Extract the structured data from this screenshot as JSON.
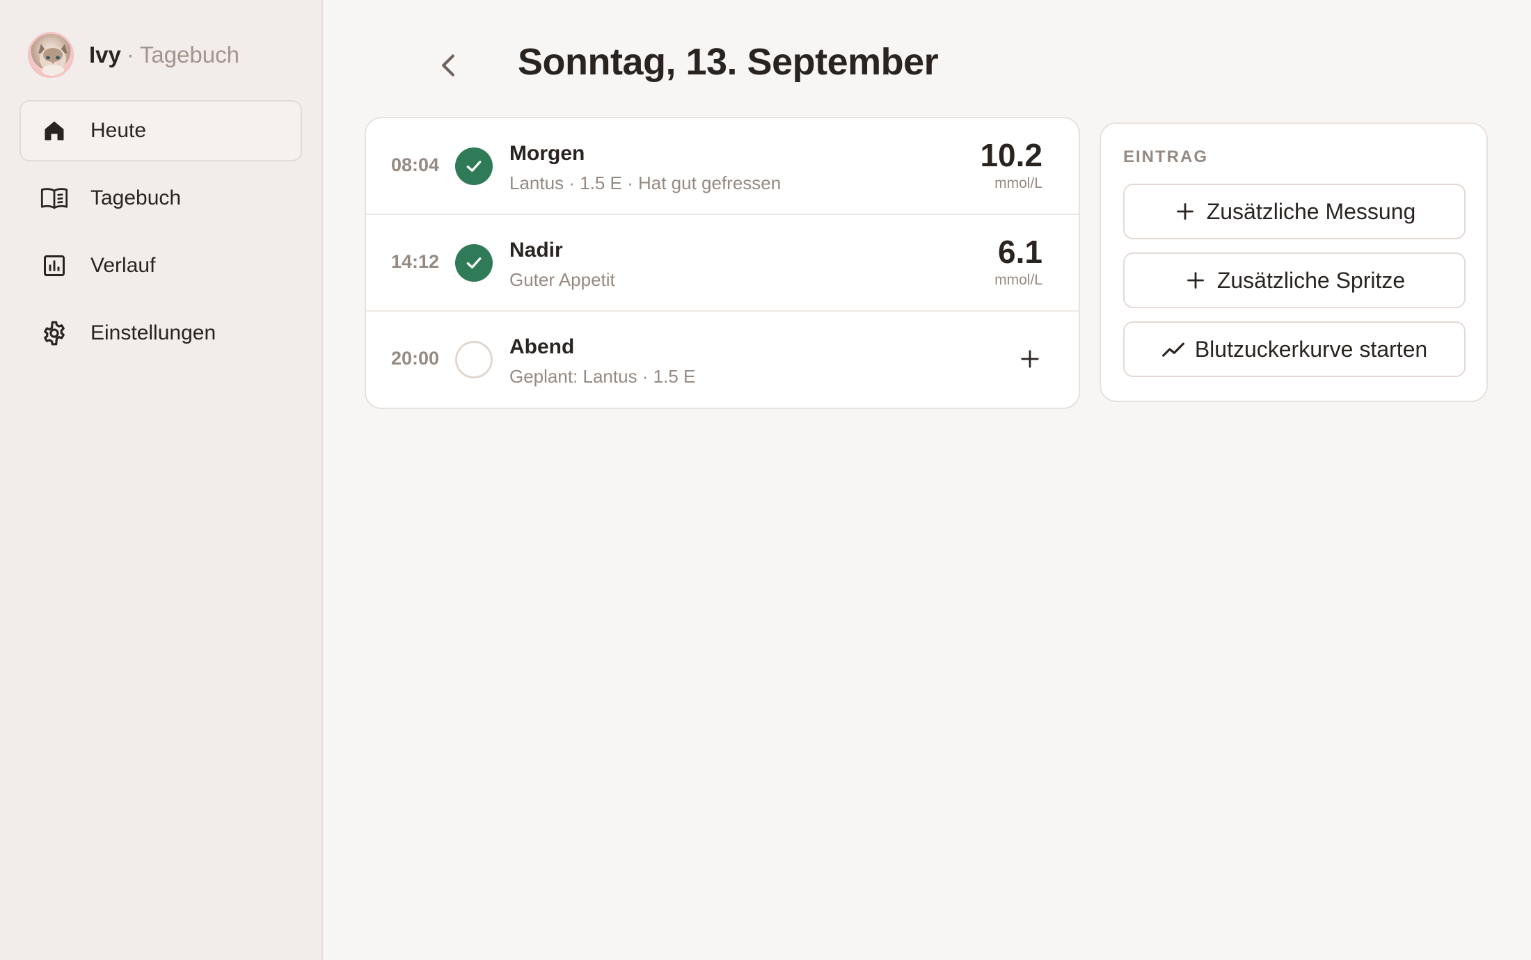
{
  "sidebar": {
    "brand": {
      "name": "Ivy",
      "separator": "·",
      "subtitle": "Tagebuch"
    },
    "items": [
      {
        "label": "Heute",
        "icon": "home-icon",
        "active": true
      },
      {
        "label": "Tagebuch",
        "icon": "book-icon",
        "active": false
      },
      {
        "label": "Verlauf",
        "icon": "chart-icon",
        "active": false
      },
      {
        "label": "Einstellungen",
        "icon": "gear-icon",
        "active": false
      }
    ]
  },
  "header": {
    "title": "Sonntag, 13. September"
  },
  "entries": [
    {
      "time": "08:04",
      "title": "Morgen",
      "subtitle": "Lantus · 1.5 E · Hat gut gefressen",
      "value": "10.2",
      "unit": "mmol/L",
      "status": "done"
    },
    {
      "time": "14:12",
      "title": "Nadir",
      "subtitle": "Guter Appetit",
      "value": "6.1",
      "unit": "mmol/L",
      "status": "done"
    },
    {
      "time": "20:00",
      "title": "Abend",
      "subtitle": "Geplant: Lantus · 1.5 E",
      "status": "open"
    }
  ],
  "panel": {
    "heading": "EINTRAG",
    "buttons": [
      {
        "label": "Zusätzliche Messung",
        "icon": "plus-icon"
      },
      {
        "label": "Zusätzliche Spritze",
        "icon": "plus-icon"
      },
      {
        "label": "Blutzuckerkurve starten",
        "icon": "trend-icon"
      }
    ]
  },
  "colors": {
    "accent_done": "#2f7a57",
    "sidebar_bg": "#f2edea",
    "page_bg": "#f8f6f4",
    "muted_text": "#958a83"
  }
}
